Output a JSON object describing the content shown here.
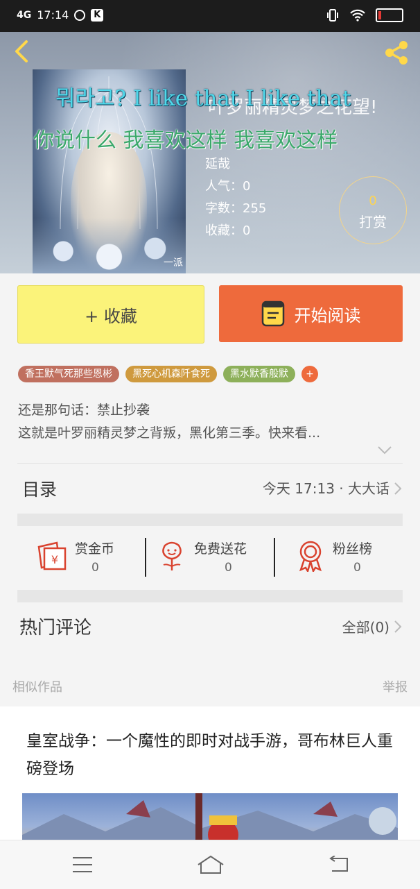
{
  "status_bar": {
    "network": "4G",
    "time": "17:14",
    "app_badge": "K",
    "battery_color": "#e53935"
  },
  "header": {
    "overlay_korean": "뭐라고? I like that I like that",
    "overlay_chinese": "你说什么 我喜欢这样 我喜欢这样",
    "title_behind": "叶罗丽精灵梦之花望!",
    "author": "延哉",
    "popularity_label": "人气：",
    "popularity": "0",
    "word_count_label": "字数：",
    "word_count": "255",
    "favorites_label": "收藏：",
    "favorites": "0",
    "tip_count": "0",
    "tip_label": "打赏",
    "cover_watermark": "一派"
  },
  "actions": {
    "collect_label": "+ 收藏",
    "read_label": "开始阅读",
    "collect_color": "#fbf37a",
    "read_color": "#ee6a3c"
  },
  "tags": [
    {
      "label": "香王默气死那些恩彬",
      "color": "#c0705f"
    },
    {
      "label": "黑死心机森阡食死",
      "color": "#cf9a3e"
    },
    {
      "label": "黑水默香般默",
      "color": "#8db05a"
    }
  ],
  "tags_more": "+",
  "description": {
    "line1": "还是那句话：禁止抄袭",
    "line2": "这就是叶罗丽精灵梦之背叛，黑化第三季。快来看..."
  },
  "catalog": {
    "label": "目录",
    "latest": "今天 17:13 · 大大话"
  },
  "stats": [
    {
      "label": "赏金币",
      "value": "0",
      "icon": "coin-envelope-icon"
    },
    {
      "label": "免费送花",
      "value": "0",
      "icon": "flower-icon"
    },
    {
      "label": "粉丝榜",
      "value": "0",
      "icon": "medal-icon"
    }
  ],
  "comments": {
    "label": "热门评论",
    "all": "全部(0)"
  },
  "similar_label": "相似作品",
  "report_label": "举报",
  "ad": {
    "title": "皇室战争：一个魔性的即时对战手游，哥布林巨人重磅登场"
  },
  "navbar": {
    "menu_icon": "menu-icon",
    "home_icon": "home-icon",
    "back_icon": "back-icon"
  }
}
